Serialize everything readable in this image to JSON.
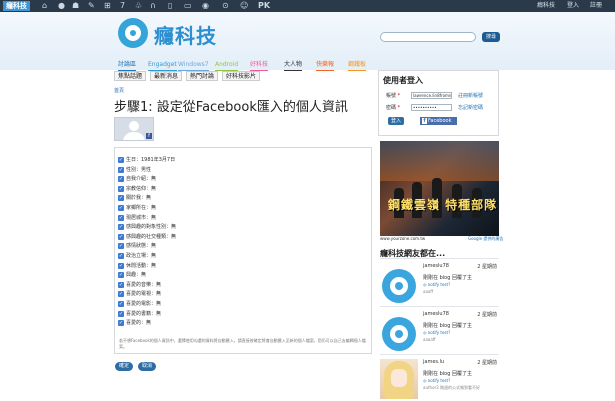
{
  "topbar": {
    "logo_label": "癮科技",
    "icons": [
      "home-icon",
      "apple-icon",
      "android-icon",
      "wrench-icon",
      "windows-icon",
      "seven-icon",
      "clover-icon",
      "headphone-icon",
      "phone-icon",
      "tablet-icon",
      "camera-icon",
      "car-icon",
      "gamepad-icon",
      "pk-icon"
    ],
    "icon_glyphs": [
      "⌂",
      "",
      "☗",
      "✎",
      "⊞",
      "7",
      "♧",
      "∩",
      "▯",
      "▭",
      "◉",
      "⊙",
      "☺",
      "PK"
    ],
    "links": [
      "癮科技",
      "登入",
      "註冊"
    ]
  },
  "brand": {
    "name": "癮科技"
  },
  "search": {
    "placeholder": "",
    "button_label": "搜尋"
  },
  "nav": {
    "items": [
      {
        "label": "討論區",
        "color": "#2273b5"
      },
      {
        "label": "Engadget",
        "color": "#2e9cd6"
      },
      {
        "label": "Windows7",
        "color": "#6aa7df"
      },
      {
        "label": "Android",
        "color": "#8dc63f"
      },
      {
        "label": "好科技",
        "color": "#e95c9a"
      },
      {
        "label": "大人物",
        "color": "#333333"
      },
      {
        "label": "快樂報",
        "color": "#f26522"
      },
      {
        "label": "鋼鐵板",
        "color": "#f7941d"
      }
    ]
  },
  "subnav": {
    "items": [
      "焦點話題",
      "最新消息",
      "熱門討論",
      "好科技影片"
    ]
  },
  "breadcrumb": "首頁",
  "page_title": "步驟1: 設定從Facebook匯入的個人資訊",
  "info": {
    "rows": [
      "生日：1981年3月7日",
      "性別：男性",
      "自我介紹：無",
      "宗教信仰：無",
      "關於我：無",
      "家鄉所在：無",
      "現居城市：無",
      "感興趣的對象性別：無",
      "感興趣的社交種類：無",
      "感情狀態：無",
      "政治立場：無",
      "休閒活動：無",
      "興趣：無",
      "喜愛的音樂：無",
      "喜愛的電視：無",
      "喜愛的電影：無",
      "喜愛的書籍：無",
      "喜愛的：無"
    ],
    "note": "若不想Facebook的個人資訊中，選擇使用勾選的資料將自動匯入，請直接按確定將會自動匯入至新的個人檔案，您仍可以自己去編輯個人檔案。"
  },
  "buttons": {
    "confirm": "確定",
    "cancel": "取消"
  },
  "login": {
    "heading": "使用者登入",
    "account_label": "帳號",
    "account_value": "lawrence.lin8fromn",
    "password_label": "密碼",
    "password_value": "••••••••••",
    "register_link": "註冊新帳號",
    "forgot_link": "忘記新密碼",
    "enter_label": "登入",
    "facebook_label": "Facebook"
  },
  "ad": {
    "title": "鋼鐵雲嶺 特種部隊",
    "caption_left": "www.yourzone.com.tw",
    "caption_right": "Google 提供的廣告"
  },
  "friends": {
    "heading": "癮科技網友都在...",
    "items": [
      {
        "name": "jameslu78",
        "time": "2 星期前",
        "action": "剛剛在 blog 回覆了主",
        "link": "◎ notify test?",
        "extra": "aaaff",
        "avatar": "wifi"
      },
      {
        "name": "jameslu78",
        "time": "2 星期前",
        "action": "剛剛在 blog 回覆了主",
        "link": "◎ notify test?",
        "extra": "aaaaff",
        "avatar": "wifi"
      },
      {
        "name": "james.lu",
        "time": "2 星期前",
        "action": "剛剛在 blog 回覆了主",
        "link": "◎ notify test?",
        "extra": "author3 剛週的公式報到看不好",
        "avatar": "anime"
      }
    ]
  }
}
